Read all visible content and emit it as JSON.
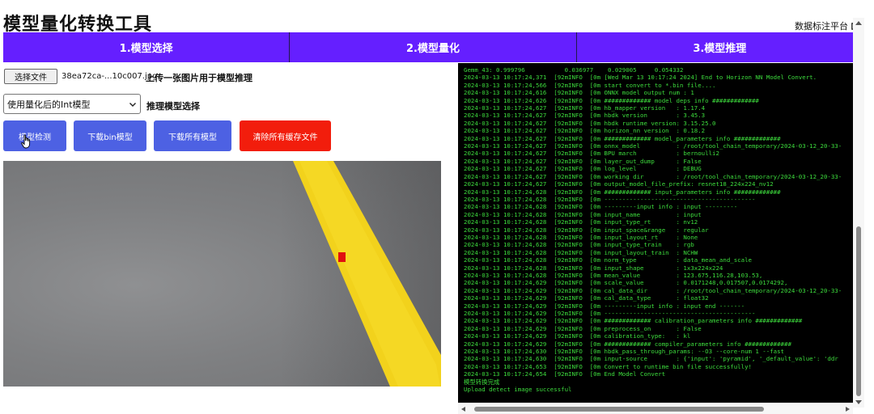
{
  "header": {
    "title": "模型量化转换工具",
    "platform_link": "数据标注平台"
  },
  "tabs": [
    {
      "label": "1.模型选择"
    },
    {
      "label": "2.模型量化"
    },
    {
      "label": "3.模型推理"
    }
  ],
  "upload": {
    "button_label": "选择文件",
    "file_name": "38ea72ca-...10c007.jpg",
    "label": "上传一张图片用于模型推理"
  },
  "model_select": {
    "selected": "使用量化后的Int模型",
    "label": "推理模型选择"
  },
  "actions": {
    "detect": "模型检测",
    "download_bin": "下载bin模型",
    "download_all": "下载所有模型",
    "clear_cache": "清除所有缓存文件"
  },
  "icons": {
    "external_link": "external-link-icon",
    "chevron": "chevron-down-icon",
    "cursor": "hand-pointer-icon"
  },
  "colors": {
    "tab_bar": "#651fff",
    "primary_button": "#4d61e3",
    "danger_button": "#f21d0c",
    "console_bg": "#000000",
    "console_text": "#3ddc3d"
  },
  "console": {
    "lines": [
      "Gemm_43: 0.999796           0.036977    0.029005     0.054332",
      "2024-03-13 10:17:24,371  [92mINFO  [0m [Wed Mar 13 10:17:24 2024] End to Horizon NN Model Convert.",
      "2024-03-13 10:17:24,566  [92mINFO  [0m start convert to *.bin file....",
      "2024-03-13 10:17:24,616  [92mINFO  [0m ONNX model output num : 1",
      "2024-03-13 10:17:24,626  [92mINFO  [0m ############# model deps info #############",
      "2024-03-13 10:17:24,627  [92mINFO  [0m hb_mapper version   : 1.17.4",
      "2024-03-13 10:17:24,627  [92mINFO  [0m hbdk version        : 3.45.3",
      "2024-03-13 10:17:24,627  [92mINFO  [0m hbdk runtime version: 3.15.25.0",
      "2024-03-13 10:17:24,627  [92mINFO  [0m horizon_nn version  : 0.18.2",
      "2024-03-13 10:17:24,627  [92mINFO  [0m ############# model_parameters info #############",
      "2024-03-13 10:17:24,627  [92mINFO  [0m onnx_model          : /root/tool_chain_temporary/2024-03-12_20-33-",
      "2024-03-13 10:17:24,627  [92mINFO  [0m BPU march           : bernoulli2",
      "2024-03-13 10:17:24,627  [92mINFO  [0m layer_out_dump      : False",
      "2024-03-13 10:17:24,627  [92mINFO  [0m log_level           : DEBUG",
      "2024-03-13 10:17:24,627  [92mINFO  [0m working dir         : /root/tool_chain_temporary/2024-03-12_20-33-",
      "2024-03-13 10:17:24,627  [92mINFO  [0m output_model_file_prefix: resnet18_224x224_nv12",
      "2024-03-13 10:17:24,628  [92mINFO  [0m ############# input_parameters info #############",
      "2024-03-13 10:17:24,628  [92mINFO  [0m ------------------------------------------",
      "2024-03-13 10:17:24,628  [92mINFO  [0m ---------input info : input ---------",
      "2024-03-13 10:17:24,628  [92mINFO  [0m input_name          : input",
      "2024-03-13 10:17:24,628  [92mINFO  [0m input_type_rt       : nv12",
      "2024-03-13 10:17:24,628  [92mINFO  [0m input_space&range   : regular",
      "2024-03-13 10:17:24,628  [92mINFO  [0m input_layout_rt     : None",
      "2024-03-13 10:17:24,628  [92mINFO  [0m input_type_train    : rgb",
      "2024-03-13 10:17:24,628  [92mINFO  [0m input_layout_train  : NCHW",
      "2024-03-13 10:17:24,628  [92mINFO  [0m norm_type           : data_mean_and_scale",
      "2024-03-13 10:17:24,628  [92mINFO  [0m input_shape         : 1x3x224x224",
      "2024-03-13 10:17:24,628  [92mINFO  [0m mean_value          : 123.675,116.28,103.53,",
      "2024-03-13 10:17:24,629  [92mINFO  [0m scale_value         : 0.0171248,0.017507,0.0174292,",
      "2024-03-13 10:17:24,629  [92mINFO  [0m cal_data_dir        : /root/tool_chain_temporary/2024-03-12_20-33-",
      "2024-03-13 10:17:24,629  [92mINFO  [0m cal_data_type       : float32",
      "2024-03-13 10:17:24,629  [92mINFO  [0m ---------input info : input end -------",
      "2024-03-13 10:17:24,629  [92mINFO  [0m ------------------------------------------",
      "2024-03-13 10:17:24,629  [92mINFO  [0m ############# calibration_parameters info #############",
      "2024-03-13 10:17:24,629  [92mINFO  [0m preprocess_on       : False",
      "2024-03-13 10:17:24,629  [92mINFO  [0m calibration_type:   : kl",
      "2024-03-13 10:17:24,629  [92mINFO  [0m ############# compiler_parameters info #############",
      "2024-03-13 10:17:24,630  [92mINFO  [0m hbdk_pass_through_params: --O3 --core-num 1 --fast",
      "2024-03-13 10:17:24,630  [92mINFO  [0m input-source        : {'input': 'pyramid', '_default_value': 'ddr",
      "2024-03-13 10:17:24,653  [92mINFO  [0m Convert to runtime bin file successfully!",
      "2024-03-13 10:17:24,654  [92mINFO  [0m End Model Convert",
      "模型转换完成",
      "Upload detect image successful"
    ]
  }
}
